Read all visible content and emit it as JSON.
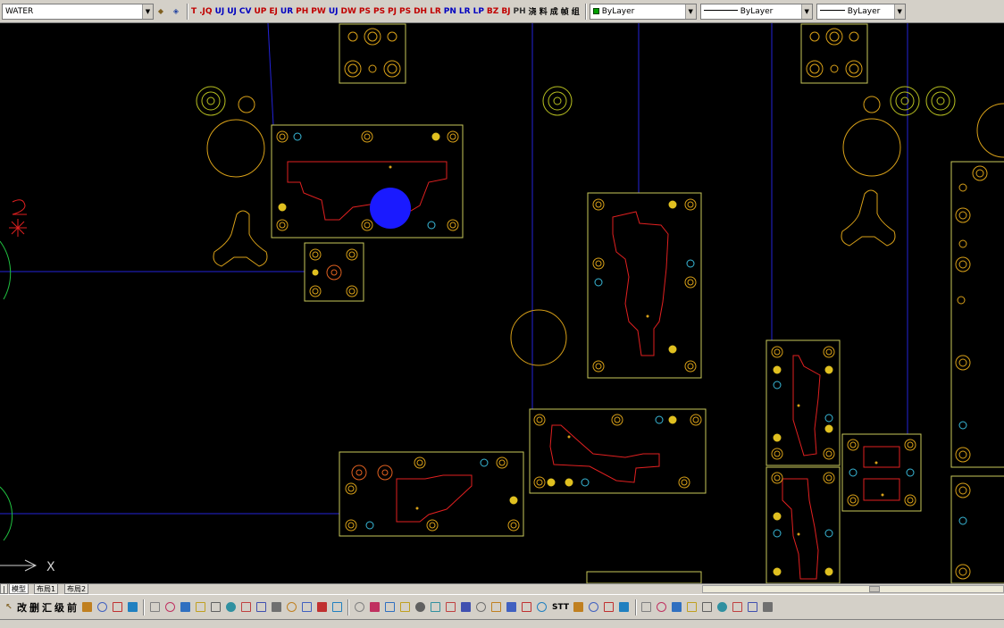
{
  "toolbar": {
    "layer_value": "WATER",
    "commands": [
      "T",
      ".JQ",
      "UJ",
      "UJ",
      "CV",
      "UP",
      "EJ",
      "UR",
      "PH",
      "PW",
      "UJ",
      "DW",
      "PS",
      "PS",
      "PJ",
      "PS",
      "DH",
      "LR",
      "PN",
      "LR",
      "LP",
      "BZ",
      "BJ",
      "PH",
      "浇",
      "料",
      "成",
      "帧",
      "组"
    ],
    "command_colors": [
      "#c00000",
      "#c00000",
      "#0000c0",
      "#0000c0",
      "#0000c0",
      "#c00000",
      "#c00000",
      "#0000c0",
      "#c00000",
      "#c00000",
      "#0000c0",
      "#c00000",
      "#c00000",
      "#c00000",
      "#c00000",
      "#c00000",
      "#c00000",
      "#c00000",
      "#0000c0",
      "#0000c0",
      "#0000c0",
      "#c00000",
      "#c00000",
      "#333333",
      "#000000",
      "#000000",
      "#000000",
      "#000000",
      "#000000"
    ],
    "color_control": "ByLayer",
    "linetype_control": "ByLayer",
    "lineweight_control": "ByLayer"
  },
  "ucs": {
    "x_label": "X"
  },
  "layout_tabs": [
    "模型",
    "布局1",
    "布局2"
  ],
  "bottom_toolbar": {
    "commands": [
      "改",
      "删",
      "汇",
      "级",
      "前"
    ],
    "tail_label": "STT"
  },
  "colors": {
    "background": "#000000",
    "plate": "#c8c85a",
    "contour": "#e02020",
    "axis": "#2323d8",
    "hole": "#d8a018",
    "cyan_hole": "#38b8d8",
    "marker": "#1a1aff"
  }
}
